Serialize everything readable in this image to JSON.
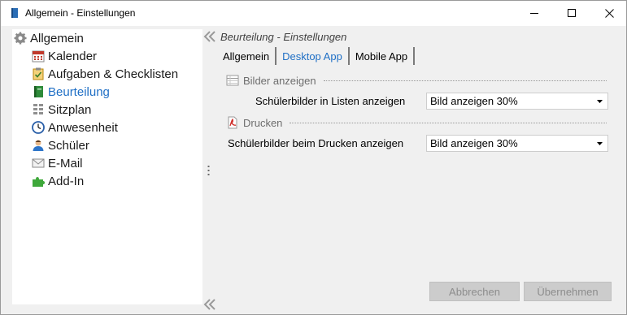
{
  "window": {
    "title": "Allgemein - Einstellungen",
    "controls": {
      "minimize": "minimize-icon",
      "maximize": "maximize-icon",
      "close": "close-icon"
    }
  },
  "sidebar": {
    "items": [
      {
        "label": "Allgemein",
        "icon": "gear-icon"
      },
      {
        "label": "Kalender",
        "icon": "calendar-icon"
      },
      {
        "label": "Aufgaben & Checklisten",
        "icon": "clipboard-icon"
      },
      {
        "label": "Beurteilung",
        "icon": "book-icon",
        "selected": true
      },
      {
        "label": "Sitzplan",
        "icon": "seat-grid-icon"
      },
      {
        "label": "Anwesenheit",
        "icon": "clock-icon"
      },
      {
        "label": "Schüler",
        "icon": "student-icon"
      },
      {
        "label": "E-Mail",
        "icon": "envelope-icon"
      },
      {
        "label": "Add-In",
        "icon": "puzzle-icon"
      }
    ]
  },
  "main": {
    "title": "Beurteilung - Einstellungen",
    "tabs": [
      {
        "label": "Allgemein",
        "active": false
      },
      {
        "label": "Desktop App",
        "active": true
      },
      {
        "label": "Mobile App",
        "active": false
      }
    ],
    "sections": [
      {
        "title": "Bilder anzeigen",
        "icon": "table-icon",
        "field": {
          "label": "Schülerbilder in Listen anzeigen",
          "value": "Bild anzeigen 30%"
        }
      },
      {
        "title": "Drucken",
        "icon": "pdf-icon",
        "field": {
          "label": "Schülerbilder beim Drucken anzeigen",
          "value": "Bild anzeigen 30%"
        }
      }
    ]
  },
  "footer": {
    "cancel_label": "Abbrechen",
    "apply_label": "Übernehmen"
  },
  "colors": {
    "accent": "#1f6fc5",
    "background": "#f0f0f0",
    "disabled_button": "#cccccc"
  }
}
